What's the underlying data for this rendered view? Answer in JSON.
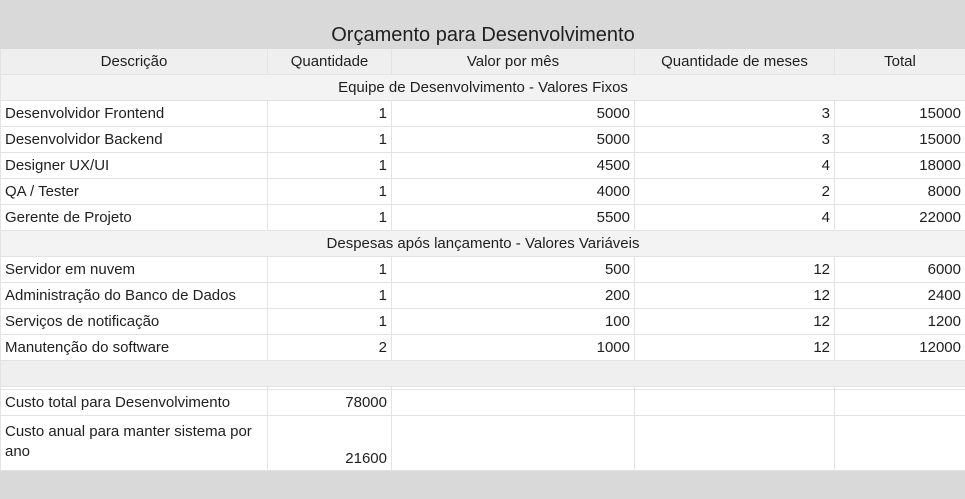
{
  "title": "Orçamento para Desenvolvimento",
  "headers": [
    "Descrição",
    "Quantidade",
    "Valor por mês",
    "Quantidade de meses",
    "Total"
  ],
  "section_fixed": "Equipe de Desenvolvimento - Valores Fixos",
  "fixed_rows": [
    [
      "Desenvolvidor Frontend",
      "1",
      "5000",
      "3",
      "15000"
    ],
    [
      "Desenvolvidor Backend",
      "1",
      "5000",
      "3",
      "15000"
    ],
    [
      "Designer UX/UI",
      "1",
      "4500",
      "4",
      "18000"
    ],
    [
      "QA / Tester",
      "1",
      "4000",
      "2",
      "8000"
    ],
    [
      "Gerente de Projeto",
      "1",
      "5500",
      "4",
      "22000"
    ]
  ],
  "section_variable": "Despesas após lançamento - Valores Variáveis",
  "variable_rows": [
    [
      "Servidor em nuvem",
      "1",
      "500",
      "12",
      "6000"
    ],
    [
      "Administração do Banco de Dados",
      "1",
      "200",
      "12",
      "2400"
    ],
    [
      "Serviços de notificação",
      "1",
      "100",
      "12",
      "1200"
    ],
    [
      "Manutenção do software",
      "2",
      "1000",
      "12",
      "12000"
    ]
  ],
  "summary": {
    "dev_total_label": "Custo total para Desenvolvimento",
    "dev_total_value": "78000",
    "annual_label": "Custo anual para manter sistema por ano",
    "annual_value": "21600"
  }
}
